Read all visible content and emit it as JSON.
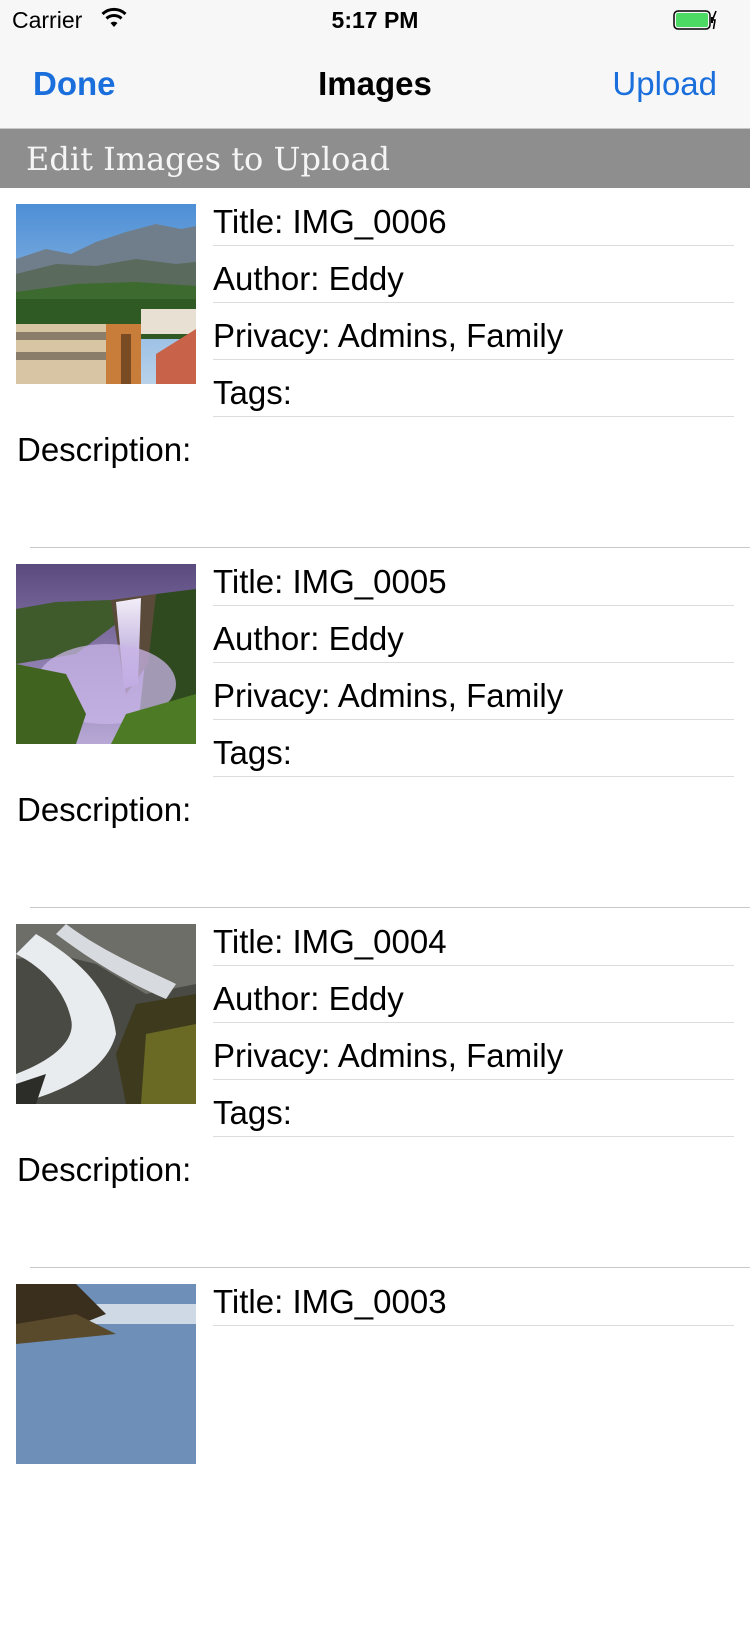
{
  "status_bar": {
    "carrier": "Carrier",
    "wifi_icon": "wifi-icon",
    "time": "5:17 PM",
    "battery_icon": "battery-charging-icon",
    "battery_color": "#4cd964"
  },
  "nav": {
    "done_label": "Done",
    "title": "Images",
    "upload_label": "Upload",
    "tint_color": "#1a6fdc"
  },
  "section": {
    "header": "Edit Images to Upload",
    "header_color": "#8e8e8e"
  },
  "images": [
    {
      "title": "Title: IMG_0006",
      "author": "Author: Eddy",
      "privacy": "Privacy: Admins, Family",
      "tags": "Tags:",
      "description": "Description:",
      "thumbnail": "mountain-town-photo"
    },
    {
      "title": "Title: IMG_0005",
      "author": "Author: Eddy",
      "privacy": "Privacy: Admins, Family",
      "tags": "Tags:",
      "description": "Description:",
      "thumbnail": "waterfall-cliff-photo"
    },
    {
      "title": "Title: IMG_0004",
      "author": "Author: Eddy",
      "privacy": "Privacy: Admins, Family",
      "tags": "Tags:",
      "description": "Description:",
      "thumbnail": "waterfall-rocks-photo"
    },
    {
      "title": "Title: IMG_0003",
      "thumbnail": "rocky-shore-photo"
    }
  ]
}
